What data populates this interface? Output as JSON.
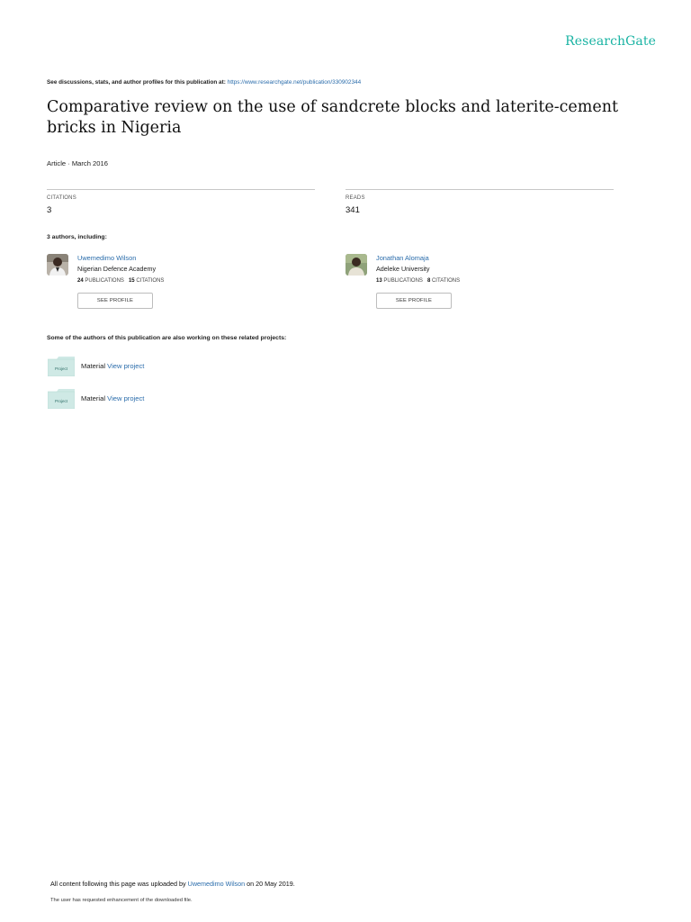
{
  "brand": {
    "name": "ResearchGate"
  },
  "header": {
    "discussions_text": "See discussions, stats, and author profiles for this publication at:",
    "url": "https://www.researchgate.net/publication/330902344"
  },
  "publication": {
    "title": "Comparative review on the use of sandcrete blocks and laterite-cement bricks in Nigeria",
    "meta": "Article · March 2016"
  },
  "stats": [
    {
      "label": "CITATIONS",
      "value": "3"
    },
    {
      "label": "READS",
      "value": "341"
    }
  ],
  "authors_heading": "3 authors, including:",
  "authors": [
    {
      "name": "Uwemedimo Wilson",
      "institution": "Nigerian Defence Academy",
      "publications_count": "24",
      "publications_label": "PUBLICATIONS",
      "citations_count": "15",
      "citations_label": "CITATIONS",
      "see_profile": "SEE PROFILE"
    },
    {
      "name": "Jonathan Alomaja",
      "institution": "Adeleke University",
      "publications_count": "13",
      "publications_label": "PUBLICATIONS",
      "citations_count": "8",
      "citations_label": "CITATIONS",
      "see_profile": "SEE PROFILE"
    }
  ],
  "projects_heading": "Some of the authors of this publication are also working on these related projects:",
  "projects": [
    {
      "icon_label": "Project",
      "name": "Material",
      "link": "View project"
    },
    {
      "icon_label": "Project",
      "name": "Material",
      "link": "View project"
    }
  ],
  "footer": {
    "upload_prefix": "All content following this page was uploaded by",
    "uploader": "Uwemedimo Wilson",
    "upload_suffix": "on 20 May 2019.",
    "note": "The user has requested enhancement of the downloaded file."
  },
  "colors": {
    "brand": "#19b3a3",
    "link": "#2a6cab",
    "project_tile": "#cfe9e5"
  }
}
